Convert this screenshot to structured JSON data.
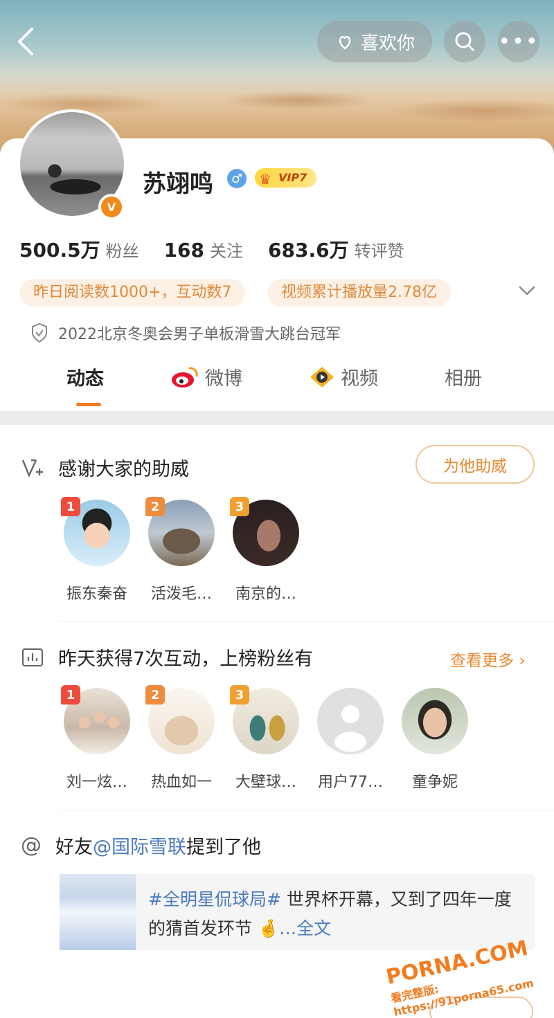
{
  "header": {
    "like_label": "喜欢你"
  },
  "profile": {
    "name": "苏翊鸣",
    "vip_label": "VIP7",
    "stats": [
      {
        "value": "500.5万",
        "label": "粉丝"
      },
      {
        "value": "168",
        "label": "关注"
      },
      {
        "value": "683.6万",
        "label": "转评赞"
      }
    ],
    "chips": [
      "昨日阅读数1000+，互动数7",
      "视频累计播放量2.78亿"
    ],
    "honor": "2022北京冬奥会男子单板滑雪大跳台冠军"
  },
  "tabs": [
    {
      "label": "动态",
      "active": true
    },
    {
      "label": "微博",
      "active": false
    },
    {
      "label": "视频",
      "active": false
    },
    {
      "label": "相册",
      "active": false
    }
  ],
  "support_section": {
    "title": "感谢大家的助威",
    "button": "为他助威",
    "fans": [
      {
        "rank": "1",
        "name": "振东秦奋"
      },
      {
        "rank": "2",
        "name": "活泼毛…"
      },
      {
        "rank": "3",
        "name": "南京的…"
      }
    ]
  },
  "interaction_section": {
    "title": "昨天获得7次互动，上榜粉丝有",
    "more": "查看更多",
    "fans": [
      {
        "rank": "1",
        "name": "刘一炫…"
      },
      {
        "rank": "2",
        "name": "热血如一"
      },
      {
        "rank": "3",
        "name": "大壁球…"
      },
      {
        "rank": "",
        "name": "用户77…"
      },
      {
        "rank": "",
        "name": "童争妮"
      }
    ]
  },
  "mention_section": {
    "prefix": "好友",
    "friend": "@国际雪联",
    "suffix": "提到了他",
    "topic": "#全明星侃球局#",
    "text": " 世界杯开幕，又到了四年一度的猜首发环节",
    "more": "…全文"
  },
  "watermark": {
    "brand": "PORNA.COM",
    "url": "看完整版: https://91porna65.com"
  },
  "colors": {
    "accent": "#f07c22",
    "link_blue": "#4a7ac0",
    "chip_bg": "#fdf1e6"
  }
}
